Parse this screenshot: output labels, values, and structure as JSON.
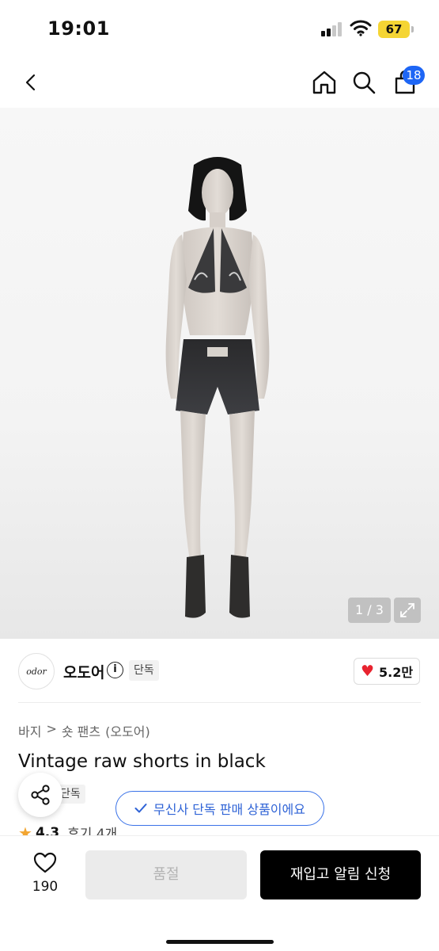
{
  "status_bar": {
    "time": "19:01",
    "battery": "67",
    "signal_icon": "cellular-signal-icon",
    "wifi_icon": "wifi-icon"
  },
  "nav": {
    "back_icon": "chevron-left-icon",
    "home_icon": "home-icon",
    "search_icon": "search-icon",
    "cart_icon": "shopping-bag-icon",
    "cart_count": "18"
  },
  "gallery": {
    "counter": "1 / 3",
    "expand_icon": "expand-icon"
  },
  "brand": {
    "logo_text": "odor",
    "name": "오도어",
    "exclusive_tag": "단독",
    "like_count": "5.2만"
  },
  "product": {
    "breadcrumb": [
      "바지",
      ">",
      "숏 팬츠",
      "(오도어)"
    ],
    "title": "Vintage raw shorts in black",
    "tag": "단독",
    "rating": "4.3",
    "reviews": "후기 4개"
  },
  "toast": {
    "text": "무신사 단독 판매 상품이에요"
  },
  "bottom_bar": {
    "wish_count": "190",
    "soldout_label": "품절",
    "restock_label": "재입고 알림 신청"
  },
  "colors": {
    "accent_blue": "#1e66f5",
    "toast_blue": "#2f63d6",
    "heart_red": "#e8232f",
    "star_orange": "#f2a531",
    "battery_yellow": "#f5d534"
  }
}
